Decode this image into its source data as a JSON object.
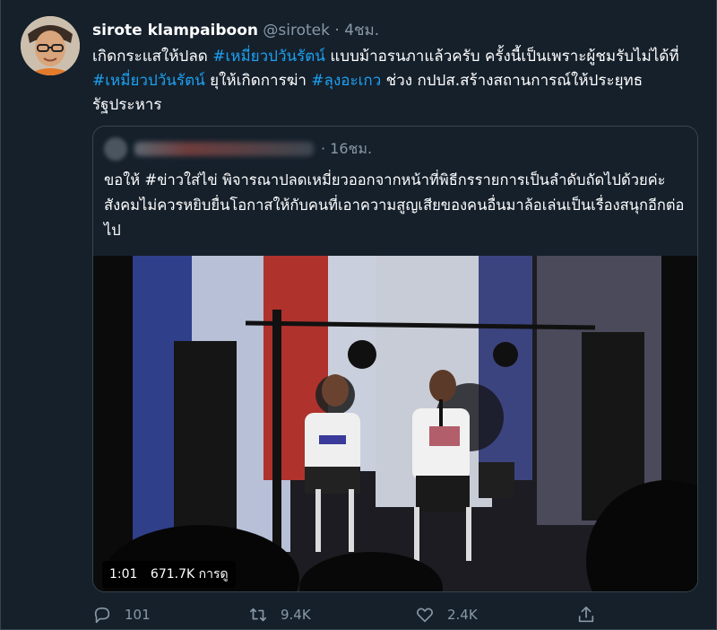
{
  "tweet": {
    "author_name": "sirote klampaiboon",
    "handle": "@sirotek",
    "separator": "·",
    "time": "4ชม.",
    "body": [
      {
        "text": "เกิดกระแสให้ปลด ",
        "tag": false
      },
      {
        "text": "#เหมี่ยวปวันรัตน์",
        "tag": true
      },
      {
        "text": " แบบม้าอรนภาแล้วครับ ครั้งนี้เป็นเพราะผู้ชมรับไม่ได้ที่ ",
        "tag": false
      },
      {
        "text": "#เหมี่ยวปวันรัตน์",
        "tag": true
      },
      {
        "text": " ยุให้เกิดการฆ่า ",
        "tag": false
      },
      {
        "text": "#ลุงอะเกว",
        "tag": true
      },
      {
        "text": " ช่วง กปปส.สร้างสถานการณ์ให้ประยุทธรัฐประหาร",
        "tag": false
      }
    ]
  },
  "quote": {
    "time": "· 16ชม.",
    "text": "ขอให้ #ข่าวใส่ไข่ พิจารณาปลดเหมี่ยวออกจากหน้าที่พิธีกรรายการเป็นลำดับถัดไปด้วยค่ะ สังคมไม่ควรหยิบยื่นโอกาสให้กับคนที่เอาความสูญเสียของคนอื่นมาล้อเล่นเป็นเรื่องสนุกอีกต่อไป",
    "video": {
      "duration": "1:01",
      "views": "671.7K การดู"
    }
  },
  "actions": {
    "reply_count": "101",
    "retweet_count": "9.4K",
    "like_count": "2.4K"
  },
  "icons": [
    "reply-icon",
    "retweet-icon",
    "like-icon",
    "share-icon"
  ],
  "colors": {
    "background": "#15202b",
    "accent": "#1da1f2",
    "secondary_text": "#8899a6",
    "border": "#38444d"
  }
}
